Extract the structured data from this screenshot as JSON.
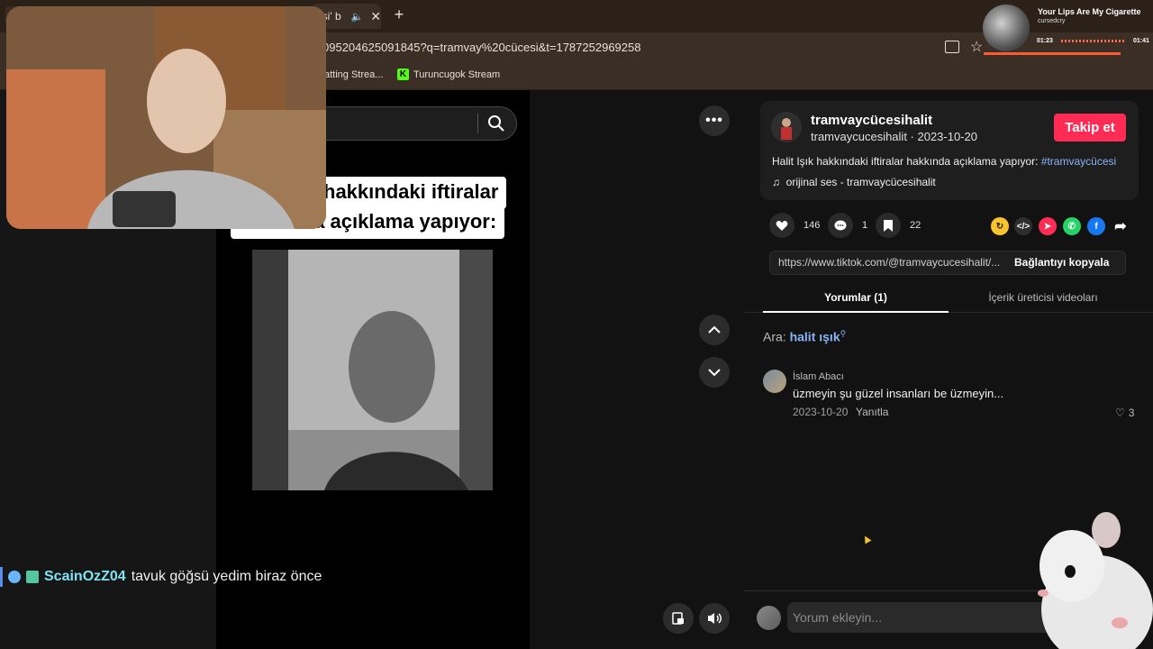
{
  "browser": {
    "tab_title": "cesi' b",
    "url": "095204625091845?q=tramvay%20cücesi&t=1787252969258",
    "bookmarks": [
      {
        "label": "atting Strea..."
      },
      {
        "label": "Turuncugok Stream",
        "icon_letter": "K"
      }
    ]
  },
  "now_playing": {
    "title": "Your Lips Are My Cigarette",
    "artist": "cursedcry",
    "current_time": "01:23",
    "end_time": "01:41"
  },
  "video": {
    "caption_line1": "hakkındaki iftiralar",
    "caption_line2": "hakkında açıklama yapıyor:"
  },
  "chat": {
    "username": "ScainOzZ04",
    "message": "tavuk göğsü yedim biraz önce"
  },
  "post": {
    "author_name": "tramvaycücesihalit",
    "author_sub": "tramvaycucesihalit · 2023-10-20",
    "follow_label": "Takip et",
    "description": "Halit Işık hakkındaki iftiralar hakkında açıklama yapıyor: ",
    "hashtag": "#tramvaycücesi",
    "music": "orijinal ses - tramvaycücesihalit",
    "likes": "146",
    "comments": "1",
    "saves": "22",
    "share_link": "https://www.tiktok.com/@tramvaycucesihalit/...",
    "copy_label": "Bağlantıyı kopyala"
  },
  "tabs": {
    "comments": "Yorumlar (1)",
    "creator_videos": "İçerik üreticisi videoları"
  },
  "related_search": {
    "prefix": "Ara: ",
    "term": "halit ışık"
  },
  "comment": {
    "user": "İslam Abacı",
    "text": "üzmeyin şu güzel insanları be üzmeyin...",
    "date": "2023-10-20",
    "reply_label": "Yanıtla",
    "likes": "3"
  },
  "comment_input": {
    "placeholder": "Yorum ekleyin..."
  },
  "icons": {
    "more": "ellipsis-icon",
    "prev": "chevron-up-icon",
    "next": "chevron-down-icon",
    "search": "search-icon"
  },
  "colors": {
    "follow": "#fe2c55",
    "hashtag": "#8ab4f8",
    "chat_user": "#7ee3f4"
  }
}
